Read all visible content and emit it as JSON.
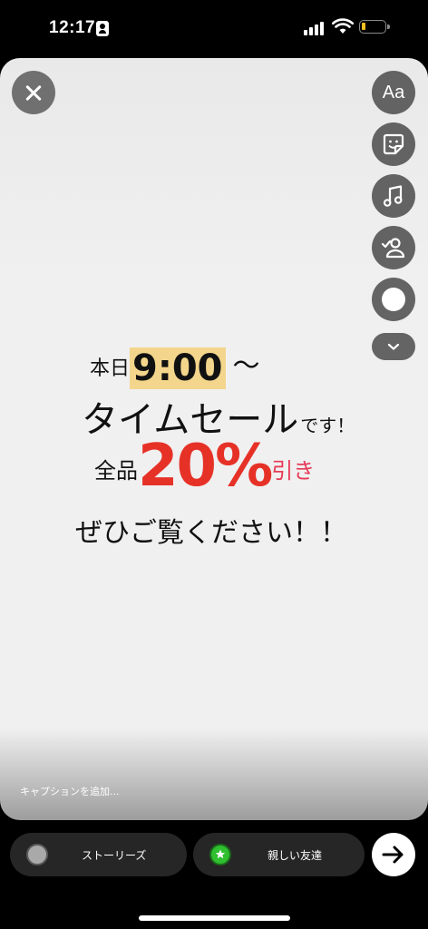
{
  "status_bar": {
    "time": "12:17"
  },
  "story": {
    "line1_small": "本日",
    "line1_time": "9:00",
    "line1_tilde": "〜",
    "line2_big": "タイムセール",
    "line2_small": "です！",
    "line3_prefix": "全品",
    "line3_percent": "20%",
    "line3_suffix": "引き",
    "line4": "ぜひご覧ください！！",
    "highlight_color": "#f3d58c",
    "percent_color": "#e63127"
  },
  "tools": {
    "text_label": "Aa",
    "icons": [
      "text-tool-icon",
      "sticker-icon",
      "music-icon",
      "mention-icon",
      "draw-circle-icon",
      "chevron-down-icon"
    ]
  },
  "caption": {
    "placeholder": "キャプションを追加..."
  },
  "bottom": {
    "stories_label": "ストーリーズ",
    "close_friends_label": "親しい友達"
  }
}
